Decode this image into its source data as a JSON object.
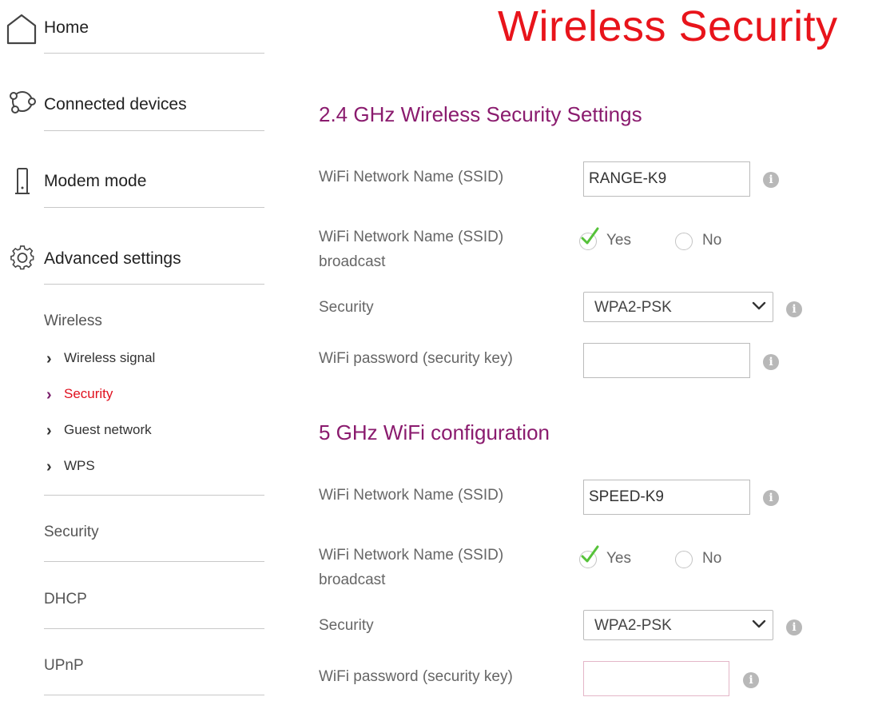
{
  "page": {
    "title": "Wireless Security"
  },
  "sidebar": {
    "main_items": [
      {
        "label": "Home",
        "icon": "home-icon"
      },
      {
        "label": "Connected devices",
        "icon": "connected-devices-icon"
      },
      {
        "label": "Modem mode",
        "icon": "modem-icon"
      },
      {
        "label": "Advanced settings",
        "icon": "gear-icon"
      }
    ],
    "wireless_heading": "Wireless",
    "wireless_items": [
      {
        "label": "Wireless signal",
        "active": false
      },
      {
        "label": "Security",
        "active": true
      },
      {
        "label": "Guest network",
        "active": false
      },
      {
        "label": "WPS",
        "active": false
      }
    ],
    "sections": [
      "Security",
      "DHCP",
      "UPnP"
    ]
  },
  "band_24": {
    "title": "2.4 GHz Wireless Security Settings",
    "ssid_label": "WiFi Network Name (SSID)",
    "ssid_value": "RANGE-K9",
    "broadcast_label_line1": "WiFi Network Name (SSID)",
    "broadcast_label_line2": "broadcast",
    "broadcast_yes": "Yes",
    "broadcast_no": "No",
    "broadcast_selected": "Yes",
    "security_label": "Security",
    "security_value": "WPA2-PSK",
    "password_label": "WiFi password (security key)",
    "password_value": ""
  },
  "band_5": {
    "title": "5 GHz WiFi configuration",
    "ssid_label": "WiFi Network Name (SSID)",
    "ssid_value": "SPEED-K9",
    "broadcast_label_line1": "WiFi Network Name (SSID)",
    "broadcast_label_line2": "broadcast",
    "broadcast_yes": "Yes",
    "broadcast_no": "No",
    "broadcast_selected": "Yes",
    "security_label": "Security",
    "security_value": "WPA2-PSK",
    "password_label": "WiFi password (security key)",
    "password_value": ""
  },
  "info_icon_glyph": "i",
  "colors": {
    "title_red": "#e8141b",
    "section_purple": "#8a1b6e",
    "active_red": "#e0101e",
    "check_green": "#56c23a"
  }
}
